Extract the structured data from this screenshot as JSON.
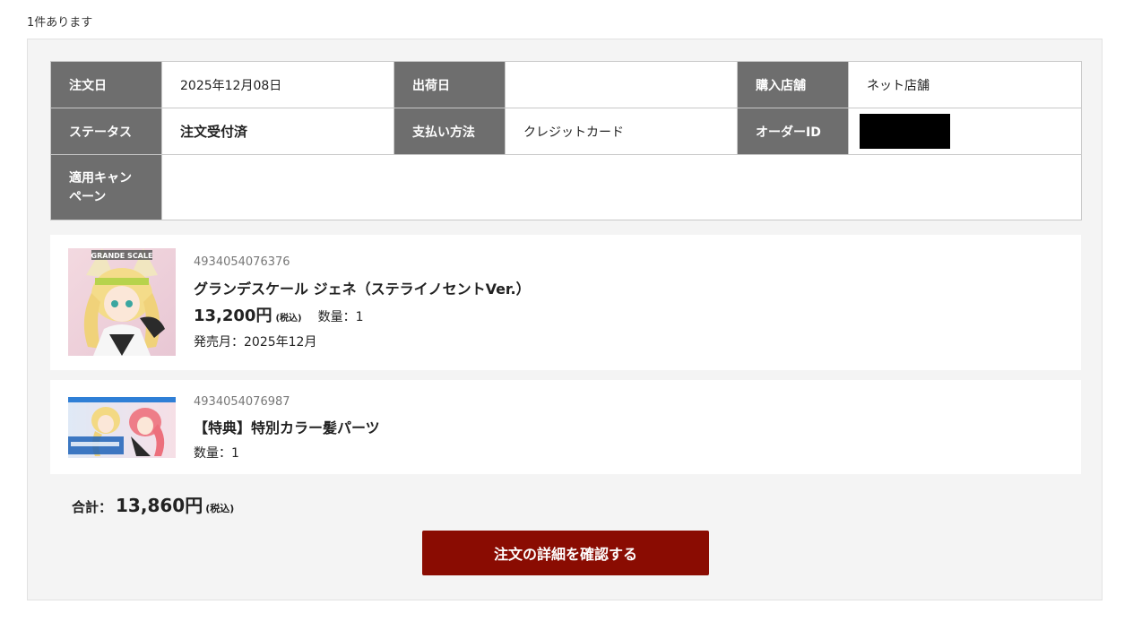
{
  "result_count": "1件あります",
  "order": {
    "order_date_label": "注文日",
    "order_date": "2025年12月08日",
    "ship_date_label": "出荷日",
    "ship_date": "",
    "store_label": "購入店舗",
    "store": "ネット店舗",
    "status_label": "ステータス",
    "status": "注文受付済",
    "payment_label": "支払い方法",
    "payment": "クレジットカード",
    "order_id_label": "オーダーID",
    "campaign_label_line1": "適用キャン",
    "campaign_label_line2": "ペーン",
    "campaign": ""
  },
  "items": [
    {
      "jan": "4934054076376",
      "name": "グランデスケール ジェネ（ステライノセントVer.）",
      "price": "13,200円",
      "tax": "(税込)",
      "quantity": "数量：1",
      "release": "発売月：2025年12月",
      "thumb_banner": "GRANDE SCALE"
    },
    {
      "jan": "4934054076987",
      "name": "【特典】特別カラー髪パーツ",
      "quantity": "数量：1"
    }
  ],
  "total": {
    "label": "合計：",
    "value": "13,860円",
    "tax": "(税込)"
  },
  "confirm_button": "注文の詳細を確認する",
  "colors": {
    "label_bg": "#6e6e6e",
    "button_bg": "#8a0c02",
    "panel_bg": "#f4f4f4"
  }
}
